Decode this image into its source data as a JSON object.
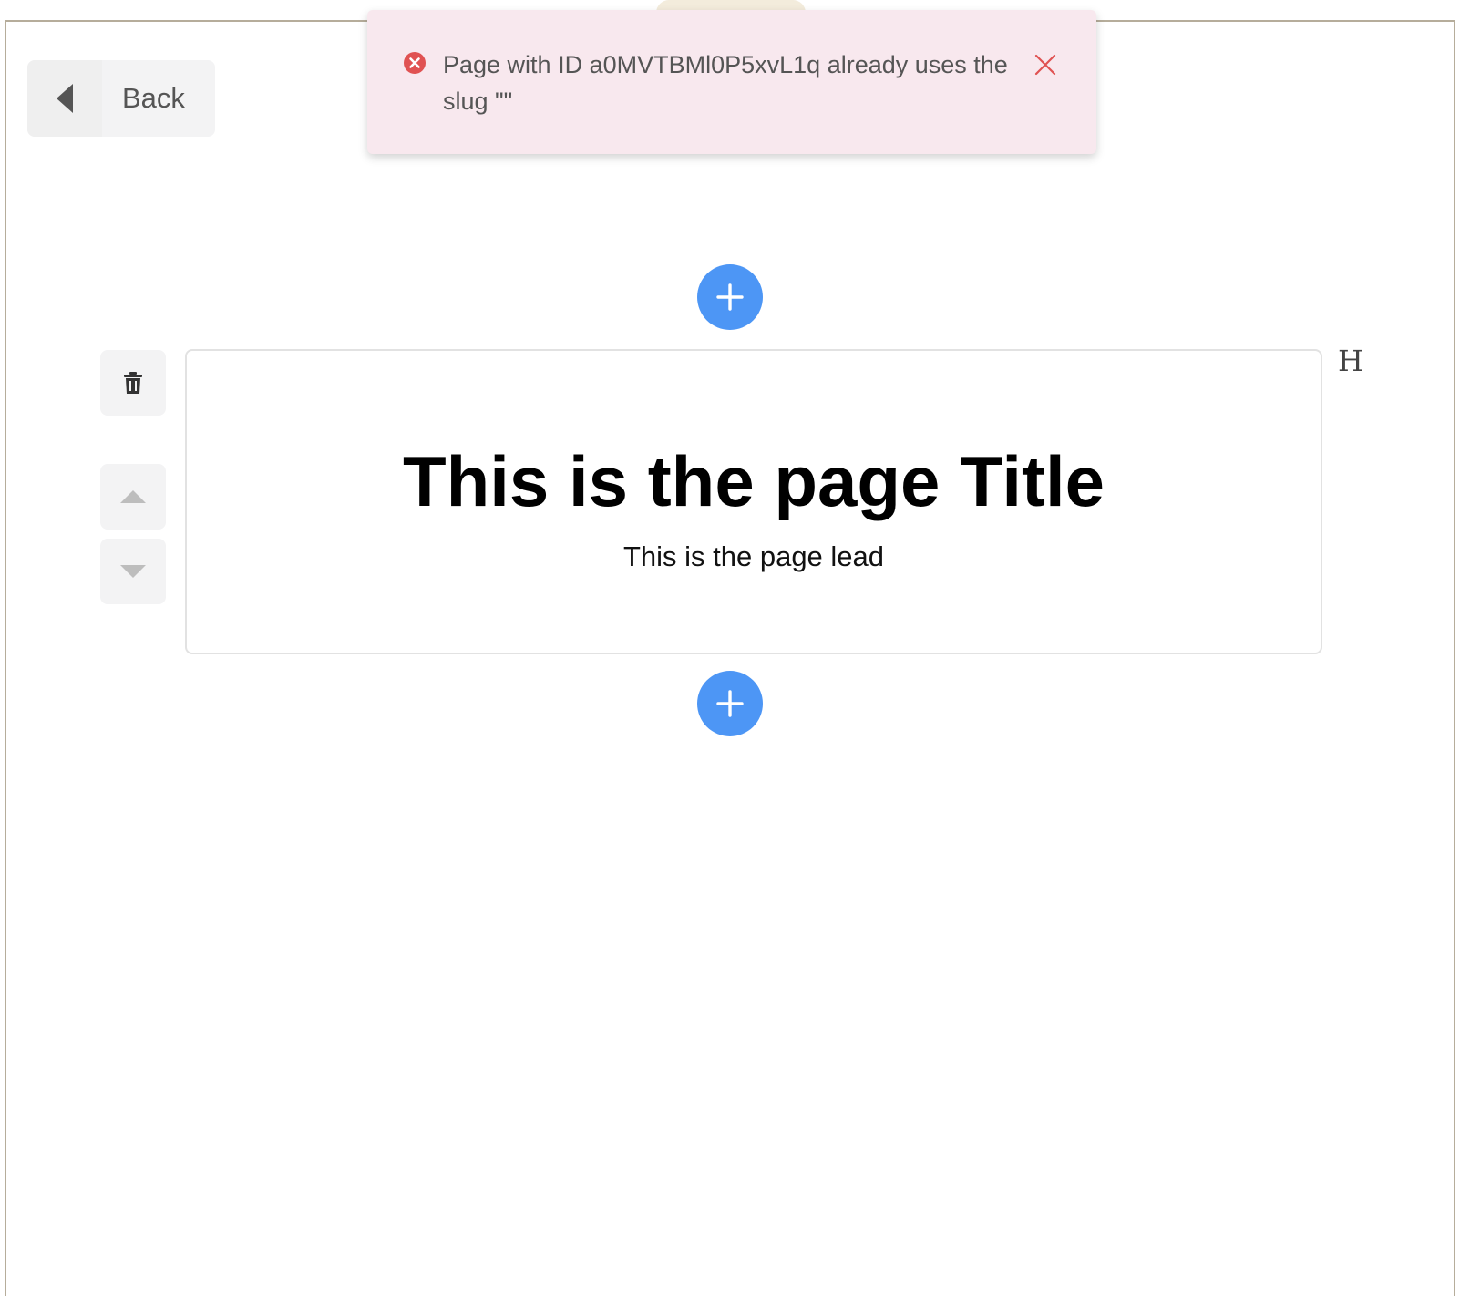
{
  "back_button": {
    "label": "Back",
    "icon": "caret-left-icon"
  },
  "toast": {
    "message": "Page with ID a0MVTBMl0P5xvL1q already uses the slug \"\"",
    "type": "error",
    "icon": "error-circle-icon",
    "close_icon": "close-icon",
    "colors": {
      "background": "#f8e8ee",
      "icon": "#e05252",
      "close": "#e05252"
    }
  },
  "editor": {
    "add_block_icon": "plus-icon",
    "accent_color": "#4d96f5",
    "block": {
      "title": "This is the page Title",
      "lead": "This is the page lead",
      "type_marker": "H"
    },
    "controls": {
      "delete_icon": "trash-icon",
      "move_up_icon": "caret-up-icon",
      "move_down_icon": "caret-down-icon"
    }
  }
}
